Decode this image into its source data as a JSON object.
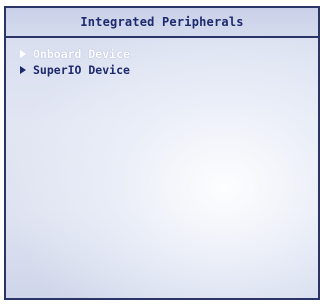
{
  "header": {
    "title": "Integrated Peripherals"
  },
  "menu": {
    "items": [
      {
        "label": "Onboard Device",
        "icon": "arrow-right-icon",
        "selected": true
      },
      {
        "label": "SuperIO Device",
        "icon": "arrow-right-icon",
        "selected": false
      }
    ]
  },
  "colors": {
    "text": "#1e2a6e",
    "selected_text": "#ffffff",
    "border": "#2a3466",
    "background": "#dfe3f1"
  }
}
